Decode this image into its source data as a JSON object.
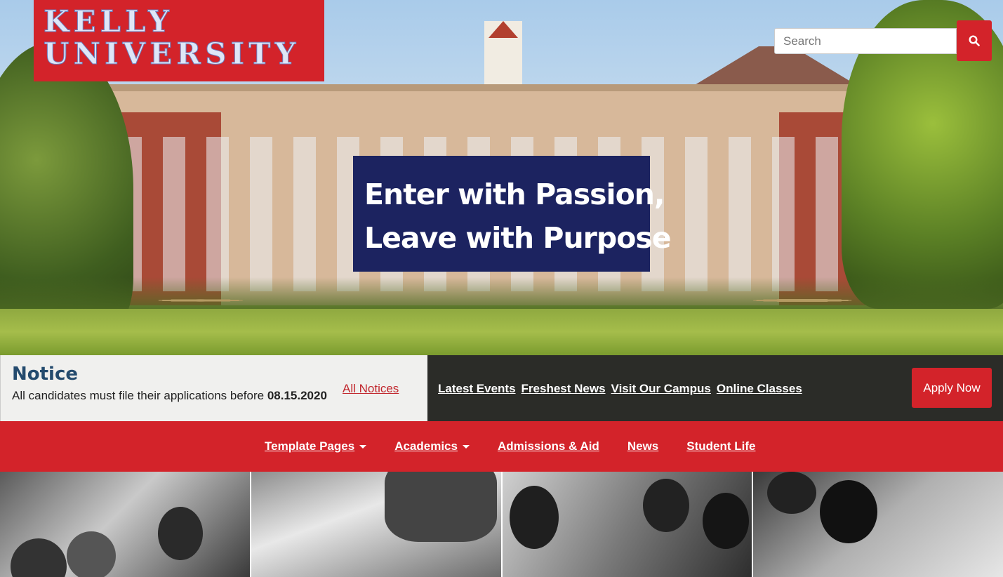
{
  "brand": {
    "line1": "KELLY",
    "line2": "UNIVERSITY",
    "color": "#d3232a"
  },
  "search": {
    "placeholder": "Search",
    "button_icon": "search-icon"
  },
  "hero": {
    "tagline_line1": "Enter with Passion,",
    "tagline_line2": "Leave with Purpose"
  },
  "notice": {
    "title": "Notice",
    "text": "All candidates must file their applications before",
    "date": "08.15.2020",
    "all_link": "All Notices"
  },
  "quick_links": [
    "Latest Events",
    "Freshest News",
    "Visit Our Campus",
    "Online Classes"
  ],
  "apply_button": "Apply Now",
  "nav": {
    "items": [
      {
        "label": "Template Pages",
        "dropdown": true
      },
      {
        "label": "Academics",
        "dropdown": true
      },
      {
        "label": "Admissions & Aid",
        "dropdown": false
      },
      {
        "label": "News",
        "dropdown": false
      },
      {
        "label": "Student Life",
        "dropdown": false
      }
    ]
  }
}
